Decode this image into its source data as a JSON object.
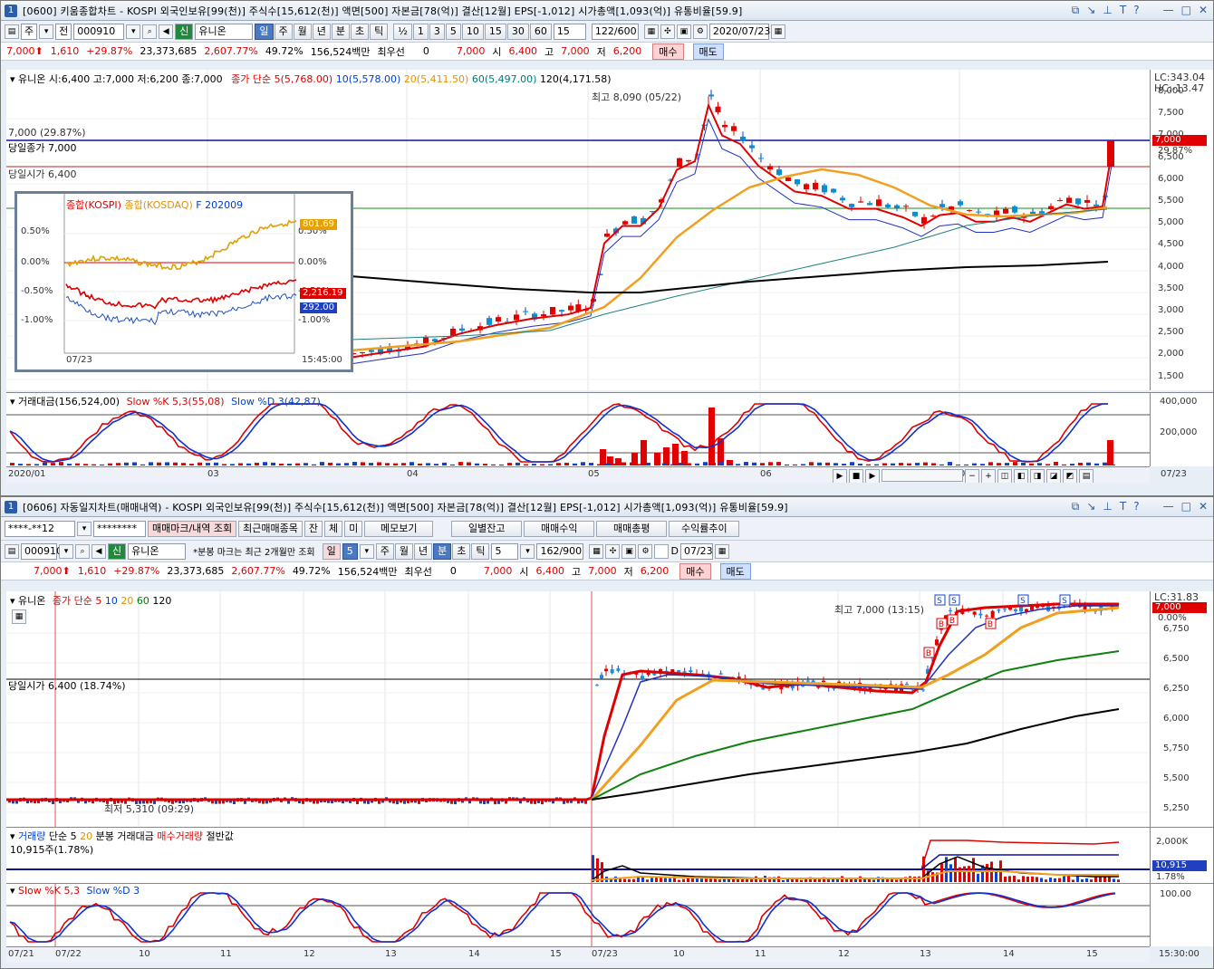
{
  "top": {
    "winno": "1",
    "title": "[0600] 키움종합차트 - KOSPI 외국인보유[99(천)] 주식수[15,612(천)] 액면[500] 자본금[78(억)] 결산[12월] EPS[-1,012] 시가총액[1,093(억)] 유통비율[59.9]",
    "toolbar": {
      "kind": "주",
      "kind2": "전",
      "code": "000910",
      "market": "신",
      "name": "유니온",
      "periods": [
        "일",
        "주",
        "월",
        "년",
        "분",
        "초",
        "틱"
      ],
      "period_active": "일",
      "nums": [
        "½",
        "1",
        "3",
        "5",
        "10",
        "15",
        "30",
        "60"
      ],
      "numsel": "15",
      "count": "122/600",
      "date": "2020/07/23"
    },
    "quote": {
      "price": "7,000",
      "change": "1,610",
      "pct": "+29.87%",
      "volume": "23,373,685",
      "vol_pct": "2,607.77%",
      "turnover": "49.72%",
      "amount": "156,524백만",
      "best": "최우선",
      "best_val": "0",
      "ask": "7,000",
      "open_lbl": "시",
      "open": "6,400",
      "high_lbl": "고",
      "high": "7,000",
      "low_lbl": "저",
      "low": "6,200",
      "buy": "매수",
      "sell": "매도"
    },
    "legend": {
      "name": "유니온 시:6,400 고:7,000 저:6,200 종:7,000",
      "ma": "종가 단순 5(5,768.00)",
      "ma10": "10(5,578.00)",
      "ma20": "20(5,411.50)",
      "ma60": "60(5,497.00)",
      "ma120": "120(4,171.58)"
    },
    "annot": {
      "high": "최고 8,090 (05/22)",
      "prev": "7,000 (29.87%)",
      "close": "당일종가 7,000",
      "open": "당일시가 6,400"
    },
    "yaxis": {
      "lc": "LC:343.04",
      "hc": "HC:-13.47",
      "ticks": [
        "8,000",
        "7,500",
        "7,000",
        "6,500",
        "6,000",
        "5,500",
        "5,000",
        "4,500",
        "4,000",
        "3,500",
        "3,000",
        "2,500",
        "2,000",
        "1,500"
      ],
      "price_tag": "7,000",
      "pct_tag": "29.87%"
    },
    "sub": {
      "legend1": "거래대금(156,524,00)",
      "legend2": "Slow %K 5,3(55,08)",
      "legend3": "Slow %D 3(42,87)",
      "ticks": [
        "400,000",
        "200,000"
      ]
    },
    "xaxis": {
      "ticks": [
        "2020/01",
        "03",
        "04",
        "05",
        "06",
        "07"
      ],
      "right": "07/23"
    },
    "inset": {
      "l1": "종합(KOSPI)",
      "l2": "종합(KOSDAQ)",
      "l3": "F 202009",
      "ticks_l": [
        "0.50%",
        "0.00%",
        "-0.50%",
        "-1.00%"
      ],
      "ticks_r": [
        "0.50%",
        "0.00%",
        "-0.50%",
        "-1.00%"
      ],
      "tag1": "801.69",
      "tag2": "2,216.19",
      "tag3": "292.00",
      "date": "07/23",
      "time": "15:45:00"
    }
  },
  "bottom": {
    "winno": "1",
    "title": "[0606] 자동일지차트(매매내역) - KOSPI 외국인보유[99(천)] 주식수[15,612(천)] 액면[500] 자본금[78(억)] 결산[12월] EPS[-1,012] 시가총액[1,093(억)] 유통비율[59.9]",
    "tb1": {
      "account": "****-**12",
      "pw": "********",
      "b1": "매매마크/내역 조회",
      "b2": "최근매매종목",
      "b3": "잔",
      "b4": "체",
      "b5": "미",
      "b6": "메모보기",
      "b7": "일별잔고",
      "b8": "매매수익",
      "b9": "매매총평",
      "b10": "수익률추이"
    },
    "tb2": {
      "code": "000910",
      "market": "신",
      "name": "유니온",
      "note": "*분봉 마크는 최근 2개월만 조회",
      "p1": "일",
      "p1n": "5",
      "periods": [
        "주",
        "월",
        "년",
        "분",
        "초",
        "틱"
      ],
      "period_active": "분",
      "num": "5",
      "count": "162/900",
      "date": "07/23",
      "d": "D"
    },
    "quote": {
      "price": "7,000",
      "change": "1,610",
      "pct": "+29.87%",
      "volume": "23,373,685",
      "vol_pct": "2,607.77%",
      "turnover": "49.72%",
      "amount": "156,524백만",
      "best": "최우선",
      "best_val": "0",
      "ask": "7,000",
      "open_lbl": "시",
      "open": "6,400",
      "high_lbl": "고",
      "high": "7,000",
      "low_lbl": "저",
      "low": "6,200",
      "buy": "매수",
      "sell": "매도"
    },
    "legend": {
      "name": "유니온",
      "ma": "종가 단순 5",
      "ma10": "10",
      "ma20": "20",
      "ma60": "60",
      "ma120": "120"
    },
    "annot": {
      "high": "최고 7,000 (13:15)",
      "open": "당일시가 6,400 (18.74%)",
      "low": "최저 5,310 (09:29)"
    },
    "yaxis": {
      "lc": "LC:31.83",
      "ticks": [
        "6,750",
        "6,500",
        "6,250",
        "6,000",
        "5,750",
        "5,500",
        "5,250"
      ],
      "price_tag": "7,000",
      "pct_tag": "0.00%"
    },
    "vol": {
      "legend1": "거래량",
      "legend2": "단순 5",
      "legend3": "20",
      "legend4": "분봉 거래대금",
      "legend5": "매수거래량",
      "legend6": "절반값",
      "sub": "10,915주(1.78%)",
      "ticks": [
        "2,000K",
        "1,000K"
      ],
      "tag": "10,915",
      "tag2": "1.78%"
    },
    "stoch": {
      "legend1": "Slow %K 5,3",
      "legend2": "Slow %D 3",
      "ticks": [
        "100.00"
      ]
    },
    "xaxis": {
      "ticks": [
        "07/21",
        "07/22",
        "10",
        "11",
        "12",
        "13",
        "14",
        "15",
        "07/23",
        "10",
        "11",
        "12",
        "13",
        "14",
        "15"
      ],
      "right": "15:30:00"
    }
  }
}
